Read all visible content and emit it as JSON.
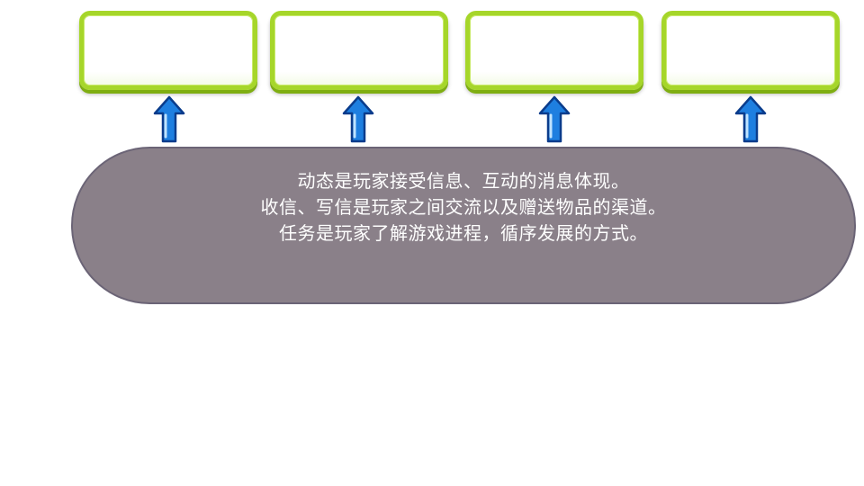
{
  "boxes": [
    {
      "label": ""
    },
    {
      "label": ""
    },
    {
      "label": ""
    },
    {
      "label": ""
    }
  ],
  "arrows": [
    {
      "icon": "arrow-up-icon"
    },
    {
      "icon": "arrow-up-icon"
    },
    {
      "icon": "arrow-up-icon"
    },
    {
      "icon": "arrow-up-icon"
    }
  ],
  "description": {
    "lines": [
      "动态是玩家接受信息、互动的消息体现。",
      "收信、写信是玩家之间交流以及赠送物品的渠道。",
      "任务是玩家了解游戏进程，循序发展的方式。"
    ]
  },
  "colors": {
    "box_border": "#a6d62a",
    "arrow_fill": "#1e7fe0",
    "pill_fill": "#8a8089"
  }
}
